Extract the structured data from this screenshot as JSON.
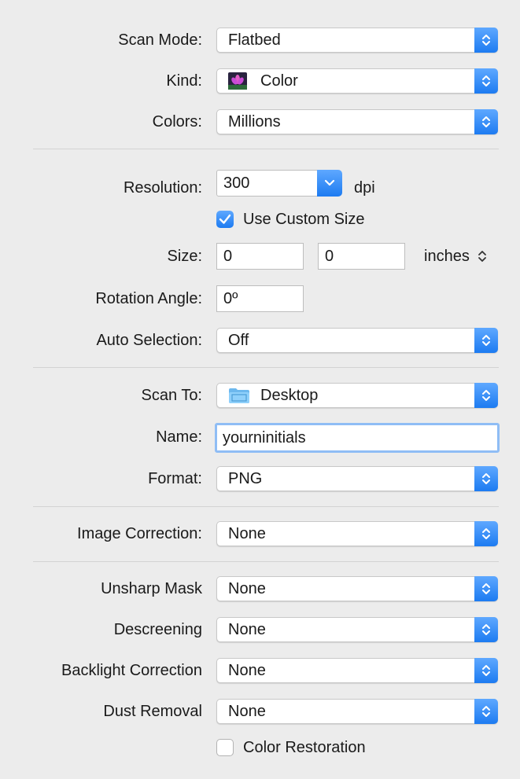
{
  "colors": {
    "accent": "#1d7bf1",
    "window_bg": "#ececec",
    "focus_ring": "#8fbdf5"
  },
  "scan_mode": {
    "label": "Scan Mode:",
    "value": "Flatbed"
  },
  "kind": {
    "label": "Kind:",
    "value": "Color",
    "icon": "flower-color-icon"
  },
  "colors_depth": {
    "label": "Colors:",
    "value": "Millions"
  },
  "resolution": {
    "label": "Resolution:",
    "value": "300",
    "unit": "dpi"
  },
  "custom_size": {
    "label": "Use Custom Size",
    "checked": true
  },
  "size": {
    "label": "Size:",
    "width": "0",
    "height": "0",
    "unit": "inches"
  },
  "rotation": {
    "label": "Rotation Angle:",
    "value": "0º"
  },
  "auto_selection": {
    "label": "Auto Selection:",
    "value": "Off"
  },
  "scan_to": {
    "label": "Scan To:",
    "value": "Desktop",
    "icon": "folder-icon"
  },
  "name": {
    "label": "Name:",
    "value": "yourninitials"
  },
  "format": {
    "label": "Format:",
    "value": "PNG"
  },
  "image_correction": {
    "label": "Image Correction:",
    "value": "None"
  },
  "unsharp_mask": {
    "label": "Unsharp Mask",
    "value": "None"
  },
  "descreening": {
    "label": "Descreening",
    "value": "None"
  },
  "backlight": {
    "label": "Backlight Correction",
    "value": "None"
  },
  "dust_removal": {
    "label": "Dust Removal",
    "value": "None"
  },
  "color_restoration": {
    "label": "Color Restoration",
    "checked": false
  }
}
